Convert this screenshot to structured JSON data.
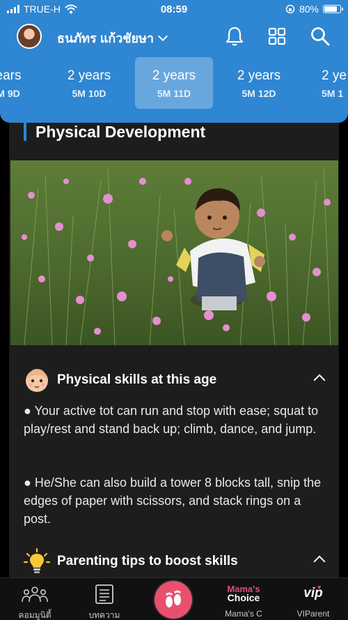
{
  "status": {
    "carrier": "TRUE-H",
    "time": "08:59",
    "battery": "80%",
    "battery_level": 0.8
  },
  "header": {
    "username": "ธนภัทร แก้วชัยษา"
  },
  "age_tabs": [
    {
      "years": "ears",
      "detail": "M 9D"
    },
    {
      "years": "2 years",
      "detail": "5M 10D"
    },
    {
      "years": "2 years",
      "detail": "5M 11D",
      "selected": true
    },
    {
      "years": "2 years",
      "detail": "5M 12D"
    },
    {
      "years": "2 ye",
      "detail": "5M 1"
    }
  ],
  "content": {
    "section_title": "Physical Development",
    "skills": {
      "title": "Physical skills at this age",
      "p1": "●  Your active tot can run and stop with ease; squat to play/rest and stand back up; climb, dance, and jump.",
      "p2": "●  He/She can also build a tower 8 blocks tall, snip the edges of paper with scissors, and stack rings on a post."
    },
    "tips": {
      "title": "Parenting tips to boost skills"
    }
  },
  "nav": {
    "community": "คอมมูนิตี้",
    "articles": "บทความ",
    "mamas_choice_logo_line1": "Mama's",
    "mamas_choice_logo_line2": "Choice",
    "mamas_choice": "Mama's C",
    "vip_logo": "vip",
    "viparent": "VIParent"
  },
  "colors": {
    "brand_blue": "#2f86d2",
    "center_button": "#e9506e",
    "content_bg": "#1d1d1d"
  }
}
